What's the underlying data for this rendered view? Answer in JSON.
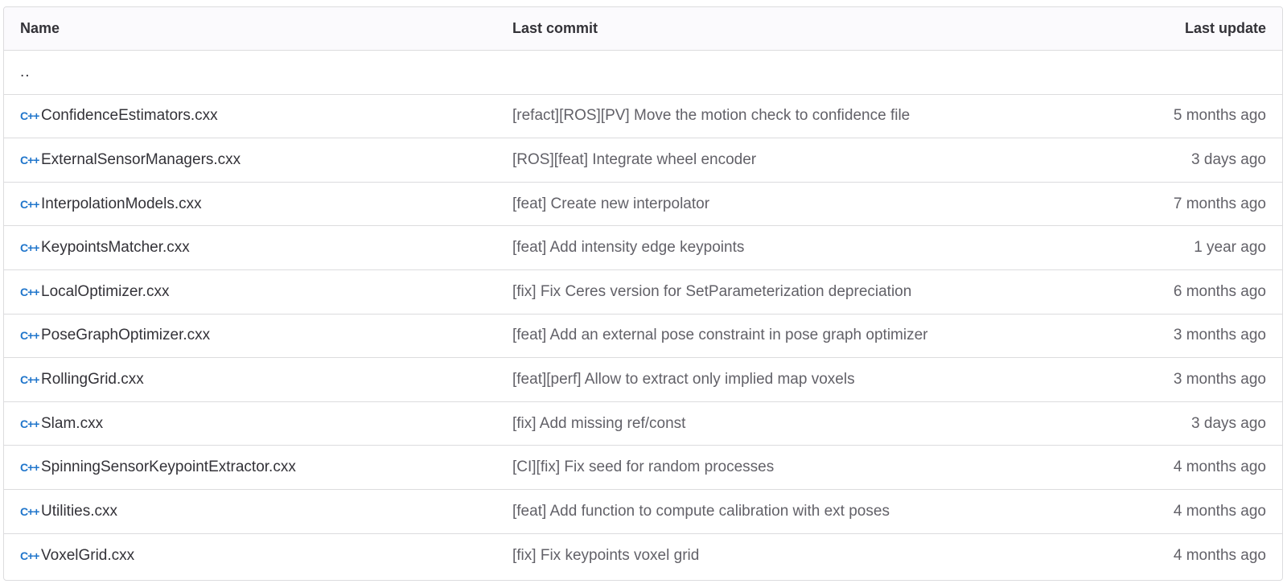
{
  "header": {
    "name": "Name",
    "last_commit": "Last commit",
    "last_update": "Last update"
  },
  "parent_link": "..",
  "icon_glyph": "C++",
  "accent_color": "#1f75cb",
  "rows": [
    {
      "name": "ConfidenceEstimators.cxx",
      "commit": "[refact][ROS][PV] Move the motion check to confidence file",
      "updated": "5 months ago"
    },
    {
      "name": "ExternalSensorManagers.cxx",
      "commit": "[ROS][feat] Integrate wheel encoder",
      "updated": "3 days ago"
    },
    {
      "name": "InterpolationModels.cxx",
      "commit": "[feat] Create new interpolator",
      "updated": "7 months ago"
    },
    {
      "name": "KeypointsMatcher.cxx",
      "commit": "[feat] Add intensity edge keypoints",
      "updated": "1 year ago"
    },
    {
      "name": "LocalOptimizer.cxx",
      "commit": "[fix] Fix Ceres version for SetParameterization depreciation",
      "updated": "6 months ago"
    },
    {
      "name": "PoseGraphOptimizer.cxx",
      "commit": "[feat] Add an external pose constraint in pose graph optimizer",
      "updated": "3 months ago"
    },
    {
      "name": "RollingGrid.cxx",
      "commit": "[feat][perf] Allow to extract only implied map voxels",
      "updated": "3 months ago"
    },
    {
      "name": "Slam.cxx",
      "commit": "[fix] Add missing ref/const",
      "updated": "3 days ago"
    },
    {
      "name": "SpinningSensorKeypointExtractor.cxx",
      "commit": "[CI][fix] Fix seed for random processes",
      "updated": "4 months ago"
    },
    {
      "name": "Utilities.cxx",
      "commit": "[feat] Add function to compute calibration with ext poses",
      "updated": "4 months ago"
    },
    {
      "name": "VoxelGrid.cxx",
      "commit": "[fix] Fix keypoints voxel grid",
      "updated": "4 months ago"
    }
  ]
}
